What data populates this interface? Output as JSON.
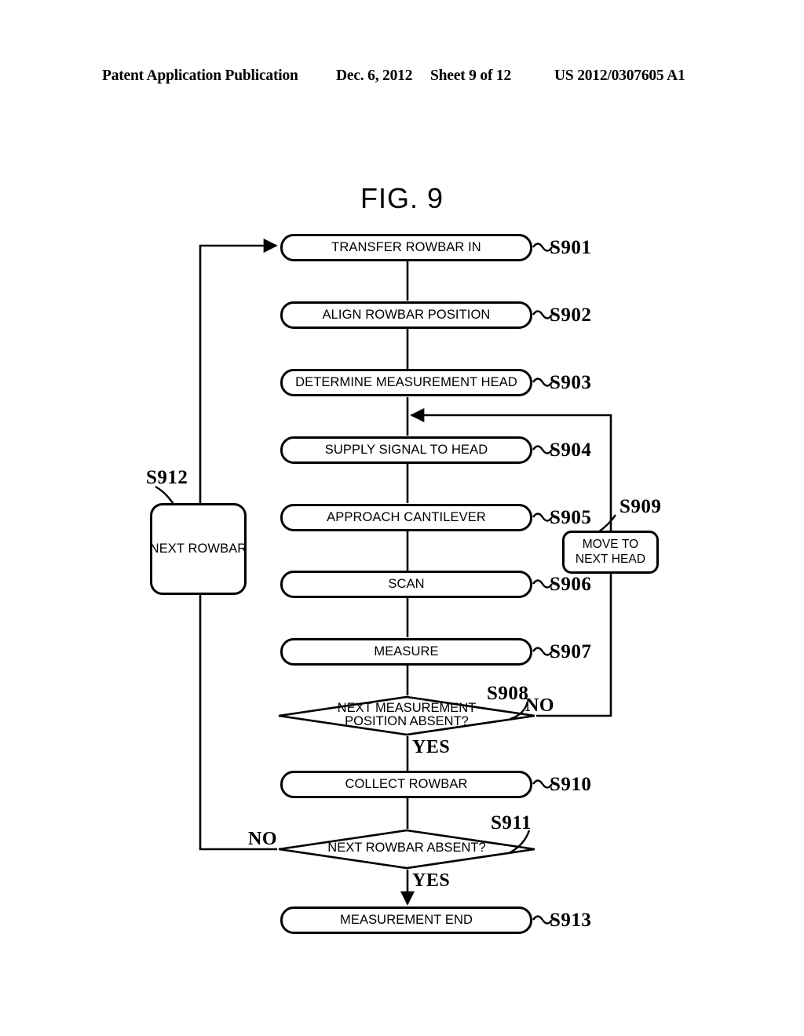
{
  "header": {
    "publication": "Patent Application Publication",
    "date": "Dec. 6, 2012",
    "sheet": "Sheet 9 of 12",
    "publication_number": "US 2012/0307605 A1"
  },
  "figure": {
    "title": "FIG. 9",
    "type": "flowchart",
    "nodes": [
      {
        "id": "S901",
        "shape": "process",
        "label": "TRANSFER ROWBAR IN"
      },
      {
        "id": "S902",
        "shape": "process",
        "label": "ALIGN ROWBAR POSITION"
      },
      {
        "id": "S903",
        "shape": "process",
        "label": "DETERMINE MEASUREMENT HEAD"
      },
      {
        "id": "S904",
        "shape": "process",
        "label": "SUPPLY SIGNAL TO HEAD"
      },
      {
        "id": "S905",
        "shape": "process",
        "label": "APPROACH CANTILEVER"
      },
      {
        "id": "S906",
        "shape": "process",
        "label": "SCAN"
      },
      {
        "id": "S907",
        "shape": "process",
        "label": "MEASURE"
      },
      {
        "id": "S908",
        "shape": "decision",
        "label_line1": "NEXT MEASUREMENT",
        "label_line2": "POSITION ABSENT?"
      },
      {
        "id": "S909",
        "shape": "process",
        "label_line1": "MOVE TO",
        "label_line2": "NEXT HEAD"
      },
      {
        "id": "S910",
        "shape": "process",
        "label": "COLLECT ROWBAR"
      },
      {
        "id": "S911",
        "shape": "decision",
        "label": "NEXT ROWBAR ABSENT?"
      },
      {
        "id": "S912",
        "shape": "process",
        "label": "NEXT ROWBAR"
      },
      {
        "id": "S913",
        "shape": "process",
        "label": "MEASUREMENT END"
      }
    ],
    "edge_labels": {
      "s908_no": "NO",
      "s908_yes": "YES",
      "s911_no": "NO",
      "s911_yes": "YES"
    },
    "refs": {
      "s901": "S901",
      "s902": "S902",
      "s903": "S903",
      "s904": "S904",
      "s905": "S905",
      "s906": "S906",
      "s907": "S907",
      "s908": "S908",
      "s909": "S909",
      "s910": "S910",
      "s911": "S911",
      "s912": "S912",
      "s913": "S913"
    },
    "colors": {
      "ink": "#000000",
      "paper": "#ffffff"
    }
  }
}
